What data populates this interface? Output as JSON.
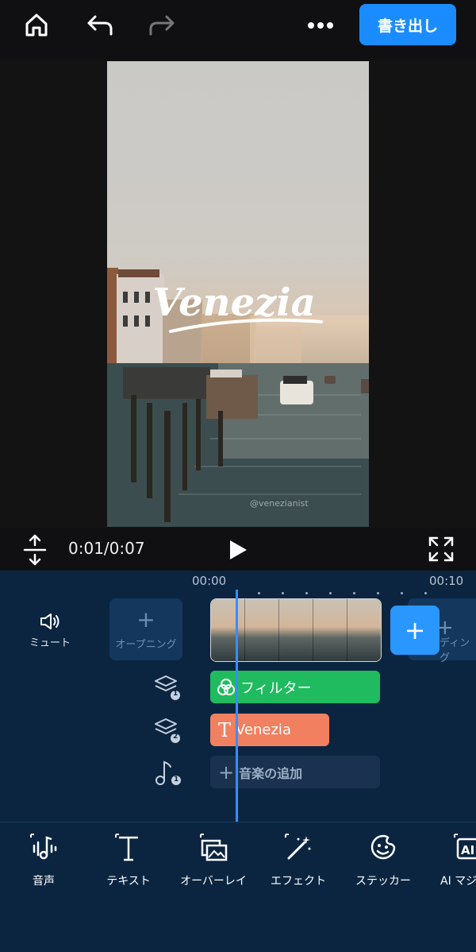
{
  "header": {
    "export_label": "書き出し"
  },
  "video": {
    "title_text": "Venezia",
    "watermark": "@venezianist"
  },
  "player": {
    "time": "0:01/0:07"
  },
  "timeline": {
    "tick_start": "00:00",
    "tick_end": "00:10",
    "mute_label": "ミュート",
    "opening_label": "オープニング",
    "ending_label": "ディング",
    "filter_label": "フィルター",
    "text_label": "Venezia",
    "music_label": "音楽の追加",
    "layer1_badge": "1",
    "layer2_badge": "2",
    "music_badge": "1"
  },
  "tools": [
    {
      "label": "音声",
      "icon": "audio-icon"
    },
    {
      "label": "テキスト",
      "icon": "text-icon"
    },
    {
      "label": "オーバーレイ",
      "icon": "overlay-icon"
    },
    {
      "label": "エフェクト",
      "icon": "effect-icon"
    },
    {
      "label": "ステッカー",
      "icon": "sticker-icon"
    },
    {
      "label": "AI マジ",
      "icon": "ai-icon"
    }
  ],
  "colors": {
    "accent": "#1a8cff",
    "timeline_bg": "#0b2541",
    "filter": "#1fbb5e",
    "text_track": "#f08060"
  }
}
